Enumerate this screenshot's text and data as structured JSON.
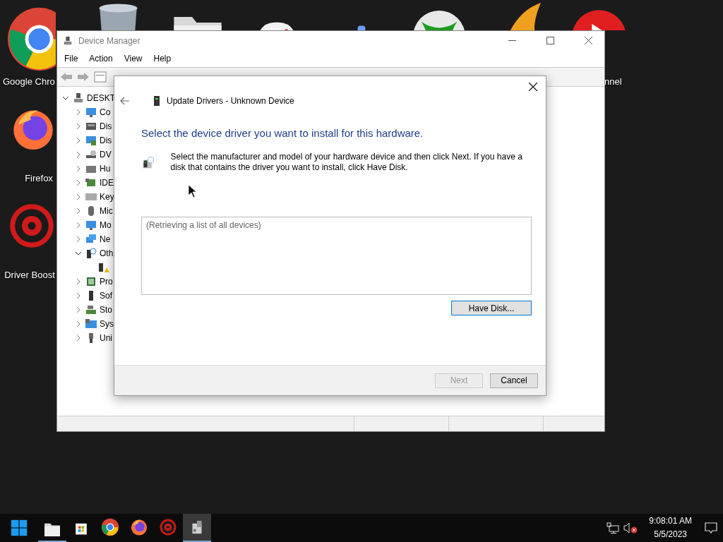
{
  "desktop": {
    "icons": [
      {
        "kind": "chrome",
        "label": "Google Chro"
      },
      {
        "kind": "firefox",
        "label": "Firefox"
      },
      {
        "kind": "booster",
        "label": "Driver Boost"
      },
      {
        "kind": "bin"
      },
      {
        "kind": "folder"
      },
      {
        "kind": "gamepad"
      },
      {
        "kind": "bluelogo"
      },
      {
        "kind": "xbox"
      },
      {
        "kind": "wings"
      },
      {
        "kind": "play",
        "label": "nnel"
      }
    ]
  },
  "device_manager": {
    "title": "Device Manager",
    "menu": [
      "File",
      "Action",
      "View",
      "Help"
    ],
    "tree": {
      "label": "DESKT",
      "kind": "computer",
      "expanded": true,
      "children": [
        {
          "label": "Co",
          "kind": "monitor",
          "expanded": false
        },
        {
          "label": "Dis",
          "kind": "disk",
          "expanded": false
        },
        {
          "label": "Dis",
          "kind": "display",
          "expanded": false
        },
        {
          "label": "DV",
          "kind": "dvd",
          "expanded": false
        },
        {
          "label": "Hu",
          "kind": "hid",
          "expanded": false
        },
        {
          "label": "IDE",
          "kind": "ide",
          "expanded": false
        },
        {
          "label": "Key",
          "kind": "keyboard",
          "expanded": false
        },
        {
          "label": "Mic",
          "kind": "mouse",
          "expanded": false
        },
        {
          "label": "Mo",
          "kind": "monitor",
          "expanded": false
        },
        {
          "label": "Ne",
          "kind": "network",
          "expanded": false
        },
        {
          "label": "Oth",
          "kind": "other",
          "expanded": true,
          "children": [
            {
              "kind": "warning"
            }
          ]
        },
        {
          "label": "Pro",
          "kind": "processor",
          "expanded": false
        },
        {
          "label": "Sof",
          "kind": "tower",
          "expanded": false
        },
        {
          "label": "Sto",
          "kind": "storage",
          "expanded": false
        },
        {
          "label": "Sys",
          "kind": "system",
          "expanded": false
        },
        {
          "label": "Uni",
          "kind": "usb",
          "expanded": false
        }
      ]
    }
  },
  "dialog": {
    "title": "Update Drivers - Unknown Device",
    "heading": "Select the device driver you want to install for this hardware.",
    "description": "Select the manufacturer and model of your hardware device and then click Next. If you have a disk that contains the driver you want to install, click Have Disk.",
    "list_text": "(Retrieving a list of all devices)",
    "have_disk": "Have Disk...",
    "buttons": [
      {
        "label": "Next",
        "disabled": true
      },
      {
        "label": "Cancel",
        "disabled": false
      }
    ]
  },
  "taskbar": {
    "apps": [
      {
        "kind": "folder",
        "selected": false,
        "running": true
      },
      {
        "kind": "store",
        "selected": false,
        "running": false
      },
      {
        "kind": "chrome",
        "selected": false,
        "running": false
      },
      {
        "kind": "firefox",
        "selected": false,
        "running": false
      },
      {
        "kind": "booster",
        "selected": false,
        "running": false
      },
      {
        "kind": "devmgr",
        "selected": true,
        "running": true
      }
    ],
    "time": "9:08:01 AM",
    "date": "5/5/2023"
  }
}
